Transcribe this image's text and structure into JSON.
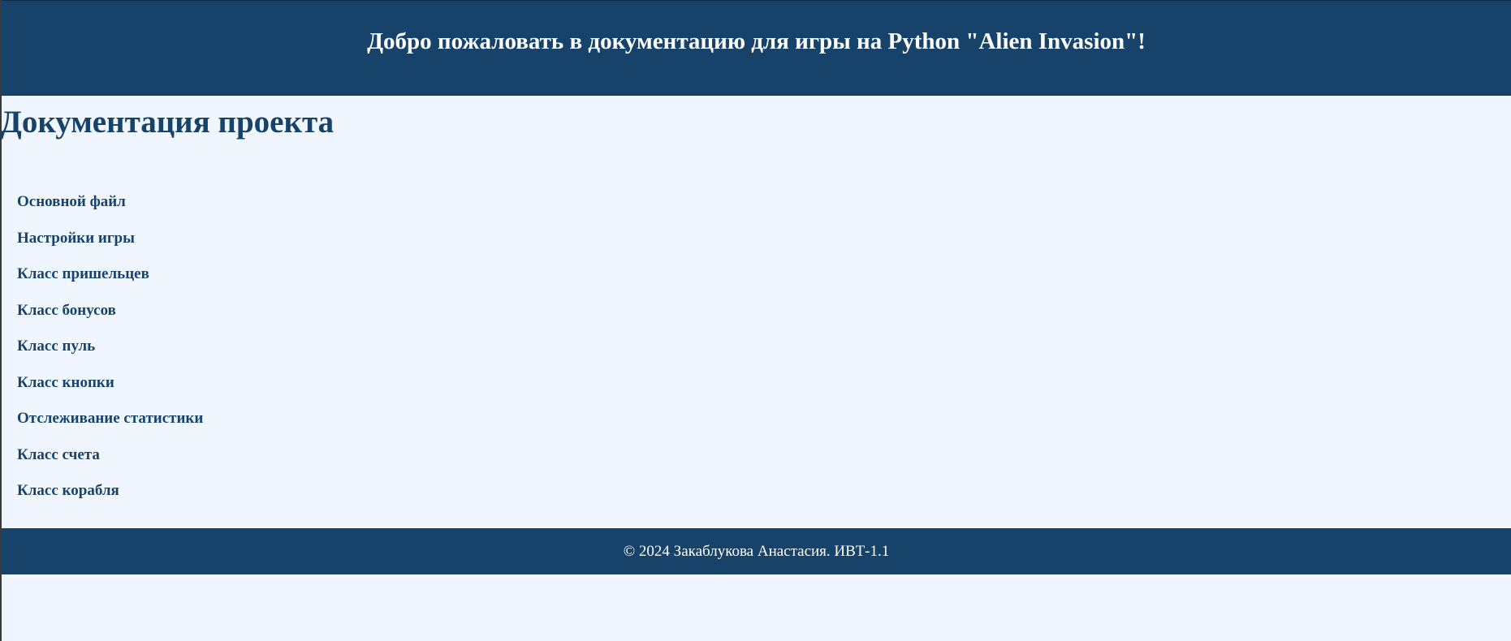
{
  "header": {
    "title": "Добро пожаловать в документацию для игры на Python \"Alien Invasion\"!"
  },
  "main": {
    "section_title": "Документация проекта",
    "nav_items": [
      {
        "label": "Основной файл"
      },
      {
        "label": "Настройки игры"
      },
      {
        "label": "Класс пришельцев"
      },
      {
        "label": "Класс бонусов"
      },
      {
        "label": "Класс пуль"
      },
      {
        "label": "Класс кнопки"
      },
      {
        "label": "Отслеживание статистики"
      },
      {
        "label": "Класс счета"
      },
      {
        "label": "Класс корабля"
      }
    ]
  },
  "footer": {
    "copyright": "© 2024 Закаблукова Анастасия. ИВТ-1.1"
  },
  "colors": {
    "primary": "#17436b",
    "background": "#f0f6fd",
    "text_on_primary": "#ffffff"
  }
}
